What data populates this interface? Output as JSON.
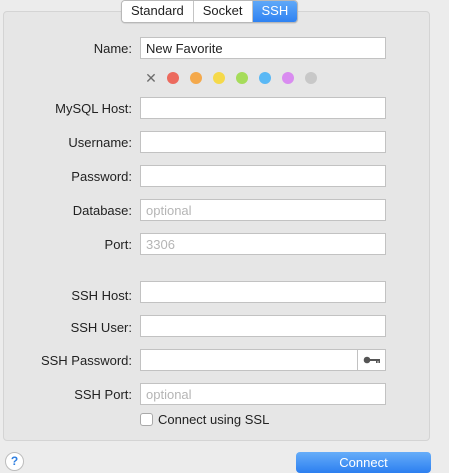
{
  "tabs": [
    {
      "label": "Standard",
      "active": false
    },
    {
      "label": "Socket",
      "active": false
    },
    {
      "label": "SSH",
      "active": true
    }
  ],
  "form": {
    "name": {
      "label": "Name:",
      "value": "New Favorite"
    },
    "color_clear_icon": "✕",
    "colors": [
      "#ec6a5e",
      "#f4a94c",
      "#f5d94a",
      "#a6dc5a",
      "#5ab8f5",
      "#d98cf0",
      "#c8c8c8"
    ],
    "mysql_host": {
      "label": "MySQL Host:",
      "value": ""
    },
    "username": {
      "label": "Username:",
      "value": ""
    },
    "password": {
      "label": "Password:",
      "value": ""
    },
    "database": {
      "label": "Database:",
      "placeholder": "optional"
    },
    "port": {
      "label": "Port:",
      "placeholder": "3306"
    },
    "ssh_host": {
      "label": "SSH Host:",
      "value": ""
    },
    "ssh_user": {
      "label": "SSH User:",
      "value": ""
    },
    "ssh_password": {
      "label": "SSH Password:",
      "value": "",
      "key_icon": "key-icon"
    },
    "ssh_port": {
      "label": "SSH Port:",
      "placeholder": "optional"
    },
    "ssl": {
      "label": "Connect using SSL",
      "checked": false
    }
  },
  "footer": {
    "help_label": "?",
    "connect_label": "Connect"
  }
}
